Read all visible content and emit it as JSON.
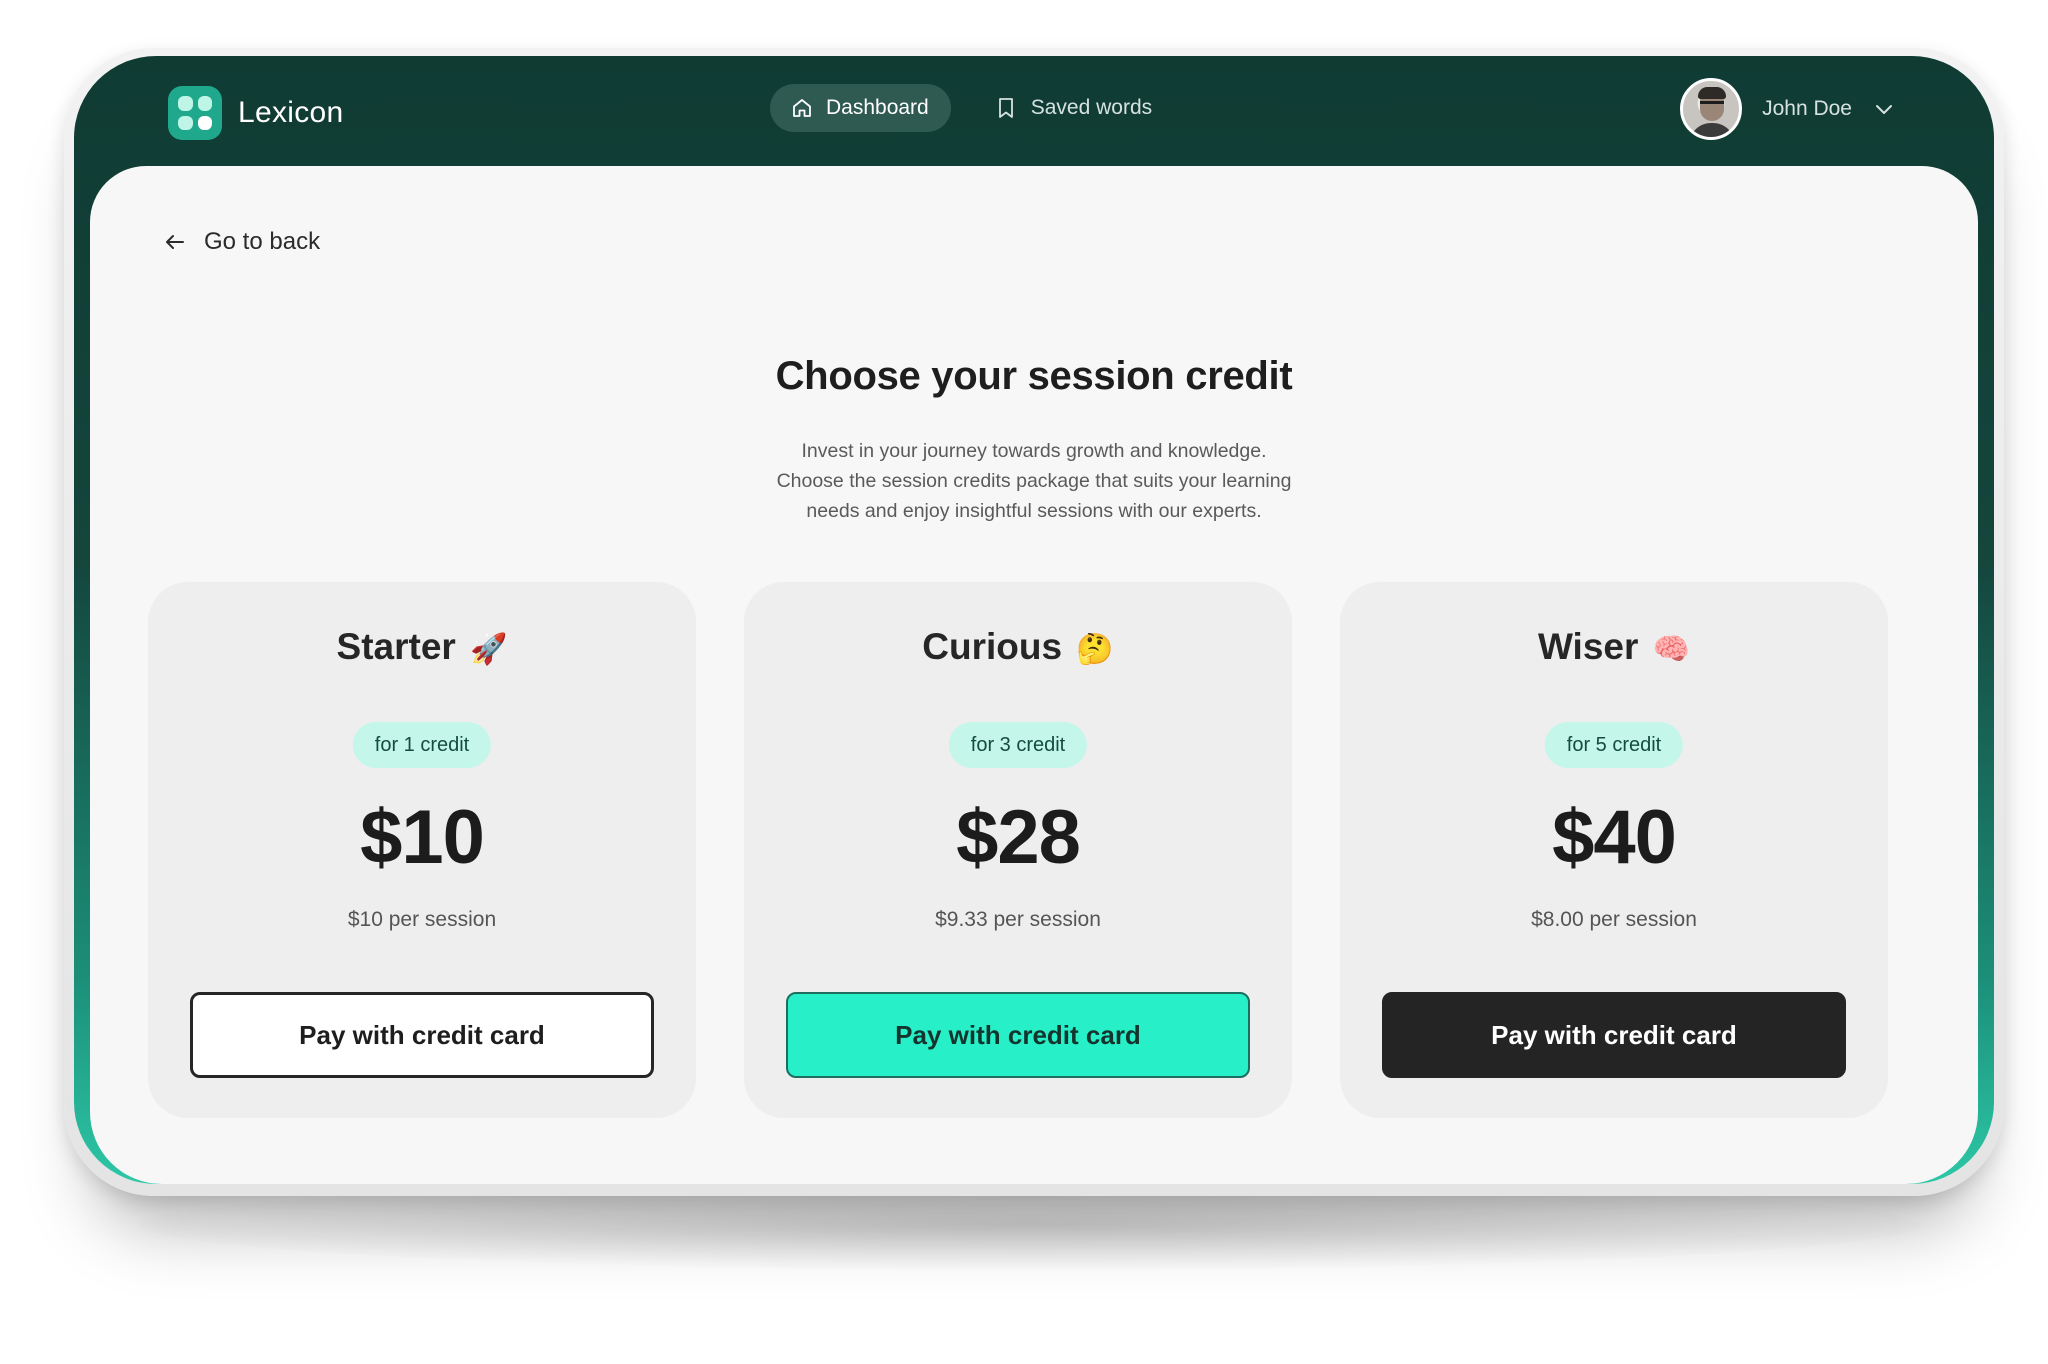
{
  "app": {
    "name": "Lexicon"
  },
  "nav": {
    "dashboard_label": "Dashboard",
    "saved_words_label": "Saved words",
    "user_name": "John Doe",
    "icons": {
      "dashboard": "home-icon",
      "saved_words": "bookmark-icon",
      "user_menu": "chevron-down-icon"
    }
  },
  "page": {
    "back_label": "Go to back",
    "title": "Choose your session credit",
    "subtitle_lines": [
      "Invest in your journey towards growth and knowledge.",
      "Choose the session credits package that suits your learning",
      "needs and enjoy insightful sessions with our experts."
    ]
  },
  "plans": [
    {
      "name": "Starter",
      "emoji": "🚀",
      "credits_label": "for 1 credit",
      "price": "$10",
      "per_session": "$10 per session",
      "button_label": "Pay with credit card",
      "button_style": "outline"
    },
    {
      "name": "Curious",
      "emoji": "🤔",
      "credits_label": "for 3 credit",
      "price": "$28",
      "per_session": "$9.33 per session",
      "button_label": "Pay with credit card",
      "button_style": "teal"
    },
    {
      "name": "Wiser",
      "emoji": "🧠",
      "credits_label": "for 5 credit",
      "price": "$40",
      "per_session": "$8.00 per session",
      "button_label": "Pay with credit card",
      "button_style": "dark"
    }
  ],
  "colors": {
    "header_bg": "#0f3b33",
    "accent_teal": "#27efc8",
    "badge_bg": "#c5f6ea",
    "card_bg": "#eeeeee",
    "dark_button": "#242424"
  }
}
